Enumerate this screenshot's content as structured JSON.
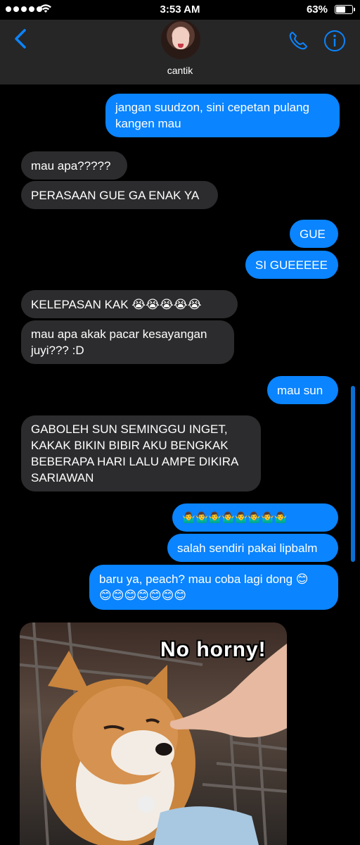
{
  "status_bar": {
    "time": "3:53 AM",
    "battery_percent": "63%",
    "battery_level": 0.63,
    "signal_bars": 5
  },
  "header": {
    "contact_name": "cantik",
    "icons": [
      "back-chevron-icon",
      "phone-icon",
      "info-icon"
    ]
  },
  "accent_color": "#0a84ff",
  "messages": [
    {
      "dir": "out",
      "text_lines": [
        "jangan suudzon, sini cepetan pulang",
        "kangen mau"
      ]
    },
    {
      "dir": "in",
      "text": "mau apa?????"
    },
    {
      "dir": "in",
      "text": "PERASAAN GUE GA ENAK YA"
    },
    {
      "dir": "out",
      "text": "GUE"
    },
    {
      "dir": "out",
      "text": "SI GUEEEEE"
    },
    {
      "dir": "in",
      "text": "KELEPASAN KAK 😭😭😭😭😭"
    },
    {
      "dir": "in",
      "text_lines": [
        "mau apa akak pacar kesayangan",
        "juyi??? :D"
      ]
    },
    {
      "dir": "out",
      "text": "mau sun"
    },
    {
      "dir": "in",
      "text_lines": [
        "GABOLEH SUN SEMINGGU INGET,",
        "KAKAK BIKIN BIBIR AKU BENGKAK",
        "BEBERAPA HARI LALU AMPE DIKIRA",
        "SARIAWAN"
      ]
    },
    {
      "dir": "out",
      "text": "🤷‍♂️🤷‍♂️🤷‍♂️🤷‍♂️🤷‍♂️🤷‍♂️🤷‍♂️🤷‍♂️"
    },
    {
      "dir": "out",
      "text": "salah sendiri pakai lipbalm"
    },
    {
      "dir": "out",
      "text_lines": [
        "baru ya, peach? mau coba lagi dong 😊",
        "😊😊😊😊😊😊😊"
      ]
    }
  ],
  "image_message": {
    "caption": "No horny!"
  }
}
